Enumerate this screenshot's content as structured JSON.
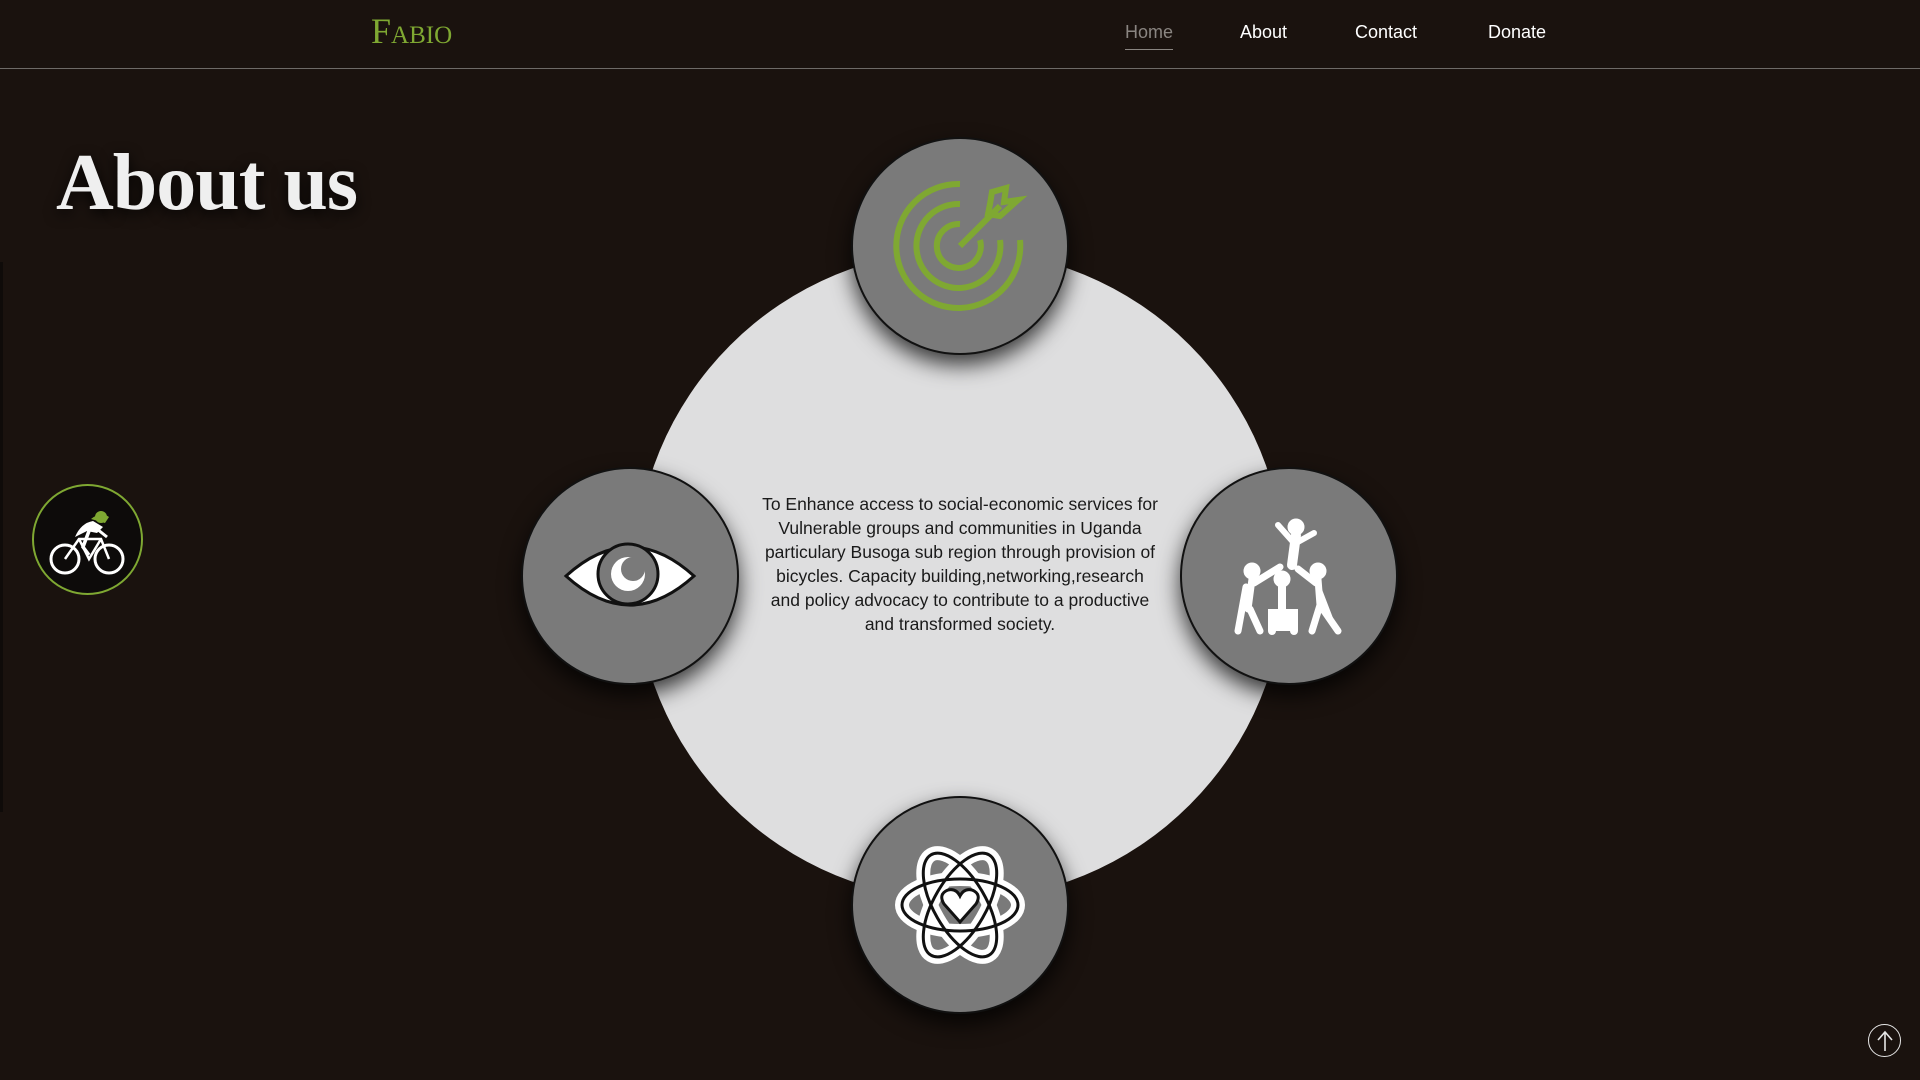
{
  "header": {
    "logo": "Fabio",
    "nav": [
      {
        "label": "Home",
        "active": true
      },
      {
        "label": "About",
        "active": false
      },
      {
        "label": "Contact",
        "active": false
      },
      {
        "label": "Donate",
        "active": false
      }
    ]
  },
  "main": {
    "title": "About us",
    "mission": "To Enhance access to social-economic services for Vulnerable groups and communities in Uganda particulary Busoga sub region through provision of bicycles. Capacity building,networking,research and policy advocacy to contribute to a productive and transformed society.",
    "nodes": [
      {
        "position": "top",
        "icon": "target-icon"
      },
      {
        "position": "left",
        "icon": "eye-icon"
      },
      {
        "position": "right",
        "icon": "teamwork-icon"
      },
      {
        "position": "bottom",
        "icon": "atom-heart-icon"
      }
    ]
  },
  "side": {
    "icon": "cyclist-icon"
  },
  "scroll_top": {
    "icon": "arrow-up-icon"
  },
  "colors": {
    "background": "#1a120e",
    "accent": "#7fa832",
    "node": "#7a7a7a",
    "circle": "#dededf",
    "nav_active": "#8a8581"
  }
}
